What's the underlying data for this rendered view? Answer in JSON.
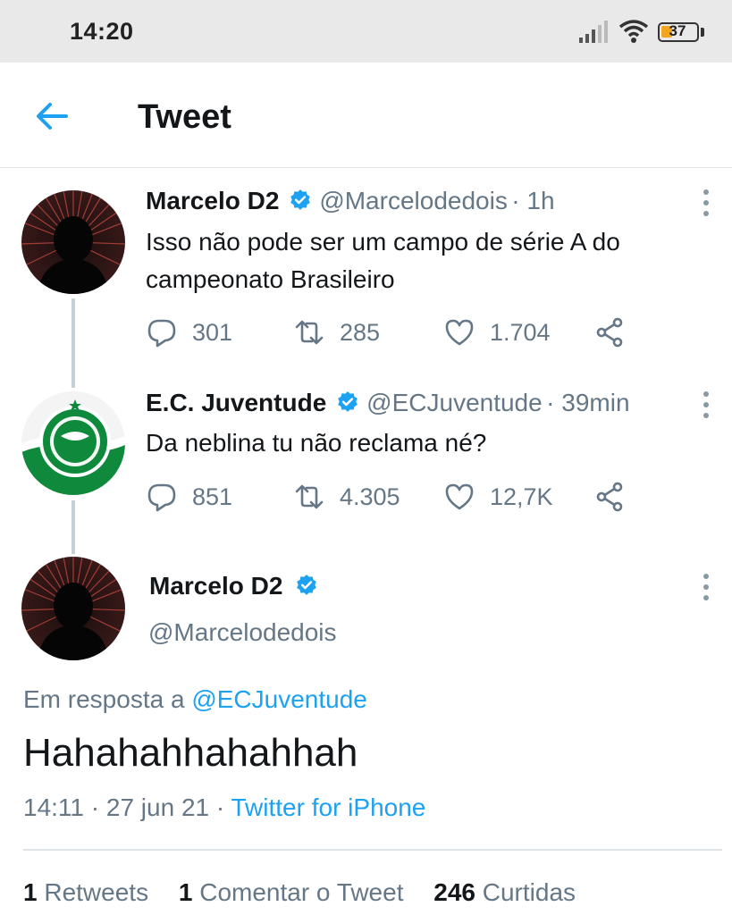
{
  "status_bar": {
    "time": "14:20",
    "battery": "37"
  },
  "header": {
    "title": "Tweet"
  },
  "thread": [
    {
      "name": "Marcelo D2",
      "handle": "@Marcelodedois",
      "time": "· 1h",
      "text": "Isso não pode ser um campo de série A do campeonato Brasileiro",
      "replies": "301",
      "retweets": "285",
      "likes": "1.704"
    },
    {
      "name": "E.C. Juventude",
      "handle": "@ECJuventude",
      "time": "· 39min",
      "text": "Da neblina tu não reclama né?",
      "replies": "851",
      "retweets": "4.305",
      "likes": "12,7K"
    }
  ],
  "focus": {
    "name": "Marcelo D2",
    "handle": "@Marcelodedois",
    "reply_prefix": "Em resposta a",
    "reply_handle": "@ECJuventude",
    "text": "Hahahahhahahhah",
    "timestamp": "14:11 · 27 jun 21 ·",
    "source": "Twitter for iPhone",
    "retweets_count": "1",
    "retweets_label": "Retweets",
    "comments_count": "1",
    "comments_label": "Comentar o Tweet",
    "likes_count": "246",
    "likes_label": "Curtidas"
  },
  "colors": {
    "accent": "#1da1f2",
    "secondary_text": "#657786",
    "juventude_green": "#0f8a3c"
  },
  "icons": [
    "back-arrow-icon",
    "verified-badge-icon",
    "more-options-icon",
    "reply-icon",
    "retweet-icon",
    "like-icon",
    "share-icon"
  ]
}
